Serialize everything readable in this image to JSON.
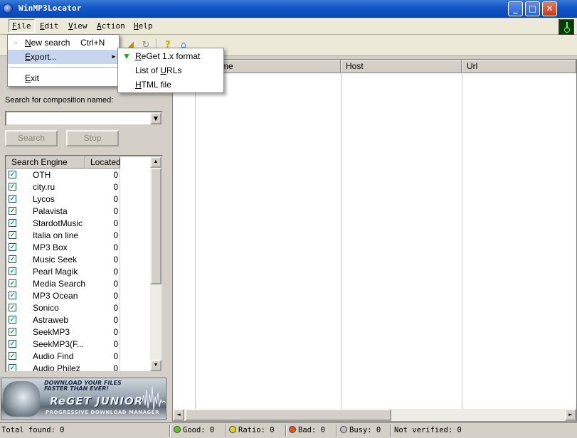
{
  "window": {
    "title": "WinMP3Locator"
  },
  "menubar": {
    "items": [
      {
        "label": "File",
        "underline": "F",
        "rest": "ile"
      },
      {
        "label": "Edit",
        "underline": "E",
        "rest": "dit"
      },
      {
        "label": "View",
        "underline": "V",
        "rest": "iew"
      },
      {
        "label": "Action",
        "underline": "A",
        "rest": "ction"
      },
      {
        "label": "Help",
        "underline": "H",
        "rest": "elp"
      }
    ]
  },
  "file_menu": {
    "new_search": {
      "u": "N",
      "rest": "ew search",
      "shortcut": "Ctrl+N"
    },
    "export": {
      "u": "E",
      "rest": "xport..."
    },
    "exit": {
      "u": "E",
      "rest": "xit"
    }
  },
  "export_submenu": {
    "reget": {
      "u": "R",
      "rest": "eGet 1.x format"
    },
    "list_urls": {
      "pre": "List of ",
      "u": "U",
      "rest": "RLs"
    },
    "html": {
      "u": "H",
      "rest": "TML file"
    }
  },
  "search": {
    "label": "Search for composition named:",
    "value": "",
    "search_button": "Search",
    "stop_button": "Stop"
  },
  "engines": {
    "headers": {
      "engine": "Search Engine",
      "located": "Located"
    },
    "rows": [
      {
        "name": "OTH",
        "count": "0",
        "checked": true
      },
      {
        "name": "city.ru",
        "count": "0",
        "checked": true
      },
      {
        "name": "Lycos",
        "count": "0",
        "checked": true
      },
      {
        "name": "Palavista",
        "count": "0",
        "checked": true
      },
      {
        "name": "StardotMusic",
        "count": "0",
        "checked": true
      },
      {
        "name": "Italia on line",
        "count": "0",
        "checked": true
      },
      {
        "name": "MP3 Box",
        "count": "0",
        "checked": true
      },
      {
        "name": "Music Seek",
        "count": "0",
        "checked": true
      },
      {
        "name": "Pearl Magik",
        "count": "0",
        "checked": true
      },
      {
        "name": "Media Search",
        "count": "0",
        "checked": true
      },
      {
        "name": "MP3 Ocean",
        "count": "0",
        "checked": true
      },
      {
        "name": "Sonico",
        "count": "0",
        "checked": true
      },
      {
        "name": "Astraweb",
        "count": "0",
        "checked": true
      },
      {
        "name": "SeekMP3",
        "count": "0",
        "checked": true
      },
      {
        "name": "SeekMP3(F...",
        "count": "0",
        "checked": true
      },
      {
        "name": "Audio Find",
        "count": "0",
        "checked": true
      },
      {
        "name": "Audio Philez",
        "count": "0",
        "checked": true
      }
    ]
  },
  "banner": {
    "line1": "DOWNLOAD YOUR FILES",
    "line2": "FASTER THAN EVER!",
    "brand": "ReGET JUNIOR",
    "tagline": "PROGRESSIVE DOWNLOAD MANAGER"
  },
  "results": {
    "headers": {
      "name": "me",
      "host": "Host",
      "url": "Url"
    }
  },
  "status": {
    "total": "Total found: 0",
    "good": "Good: 0",
    "ratio": "Ratio: 0",
    "bad": "Bad: 0",
    "busy": "Busy: 0",
    "not_verified": "Not verified: 0"
  },
  "colors": {
    "good": "#5cc52b",
    "ratio": "#e3d21c",
    "bad": "#e2541c",
    "busy": "#bdbdbd"
  }
}
